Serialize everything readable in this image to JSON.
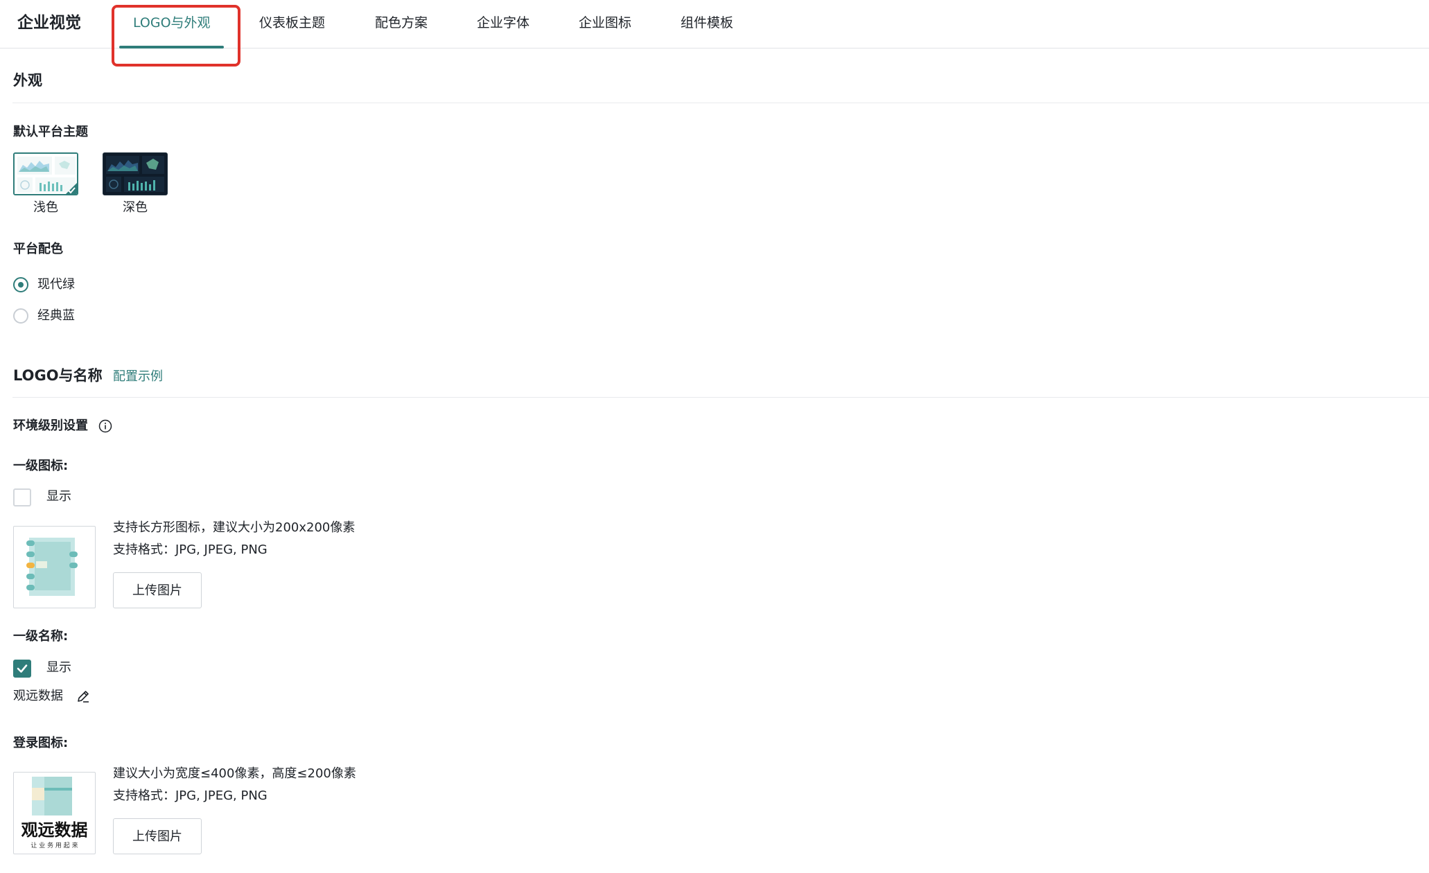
{
  "header": {
    "title": "企业视觉",
    "tabs": [
      {
        "label": "LOGO与外观",
        "active": true
      },
      {
        "label": "仪表板主题",
        "active": false
      },
      {
        "label": "配色方案",
        "active": false
      },
      {
        "label": "企业字体",
        "active": false
      },
      {
        "label": "企业图标",
        "active": false
      },
      {
        "label": "组件模板",
        "active": false
      }
    ]
  },
  "appearance": {
    "section_title": "外观",
    "default_theme": {
      "label": "默认平台主题",
      "options": [
        {
          "name": "浅色",
          "selected": true
        },
        {
          "name": "深色",
          "selected": false
        }
      ]
    },
    "platform_color": {
      "label": "平台配色",
      "options": [
        {
          "name": "现代绿",
          "selected": true
        },
        {
          "name": "经典蓝",
          "selected": false
        }
      ]
    }
  },
  "logo": {
    "section_title": "LOGO与名称",
    "example_link": "配置示例",
    "env_setting_label": "环境级别设置",
    "primary_icon": {
      "label": "一级图标:",
      "show_label": "显示",
      "show_checked": false,
      "hint_size": "支持长方形图标，建议大小为200x200像素",
      "hint_format": "支持格式：JPG, JPEG, PNG",
      "upload_label": "上传图片"
    },
    "primary_name": {
      "label": "一级名称:",
      "show_label": "显示",
      "show_checked": true,
      "value": "观远数据"
    },
    "login_icon": {
      "label": "登录图标:",
      "hint_size": "建议大小为宽度≤400像素，高度≤200像素",
      "hint_format": "支持格式：JPG, JPEG, PNG",
      "upload_label": "上传图片",
      "preview_text": "观远数据",
      "preview_slogan": "让 业 务 用 起 来"
    }
  },
  "colors": {
    "accent": "#2f7d7a",
    "highlight": "#e0322b",
    "teal_light": "#9fd3d0",
    "dark_theme_bg": "#0f1c2a"
  }
}
